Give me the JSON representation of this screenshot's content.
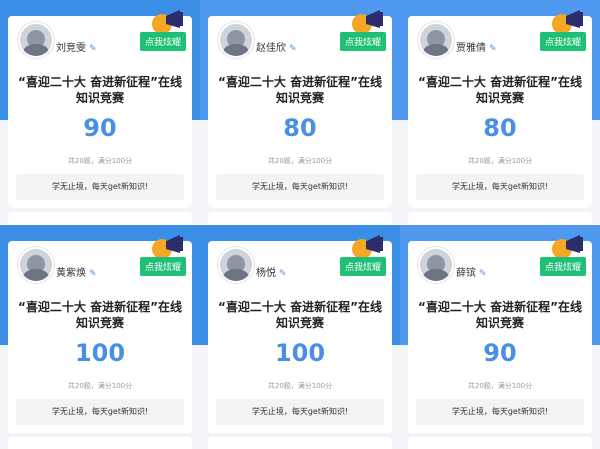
{
  "common": {
    "show_off_label": "点我炫耀",
    "quiz_title": "“喜迎二十大 奋进新征程”在线知识竞赛",
    "question_info": "共20题，满分100分",
    "motto": "学无止境，每天get新知识!"
  },
  "cards": [
    {
      "name": "刘竞雯",
      "score": "90"
    },
    {
      "name": "赵佳欣",
      "score": "80"
    },
    {
      "name": "贾雅倩",
      "score": "80"
    },
    {
      "name": "黄紫焕",
      "score": "100"
    },
    {
      "name": "杨悦",
      "score": "100"
    },
    {
      "name": "薛镔",
      "score": "90"
    }
  ],
  "colors": {
    "accent": "#4a90e2",
    "badge_green": "#1fbf76",
    "banner_blue": "#3a8ee6"
  }
}
